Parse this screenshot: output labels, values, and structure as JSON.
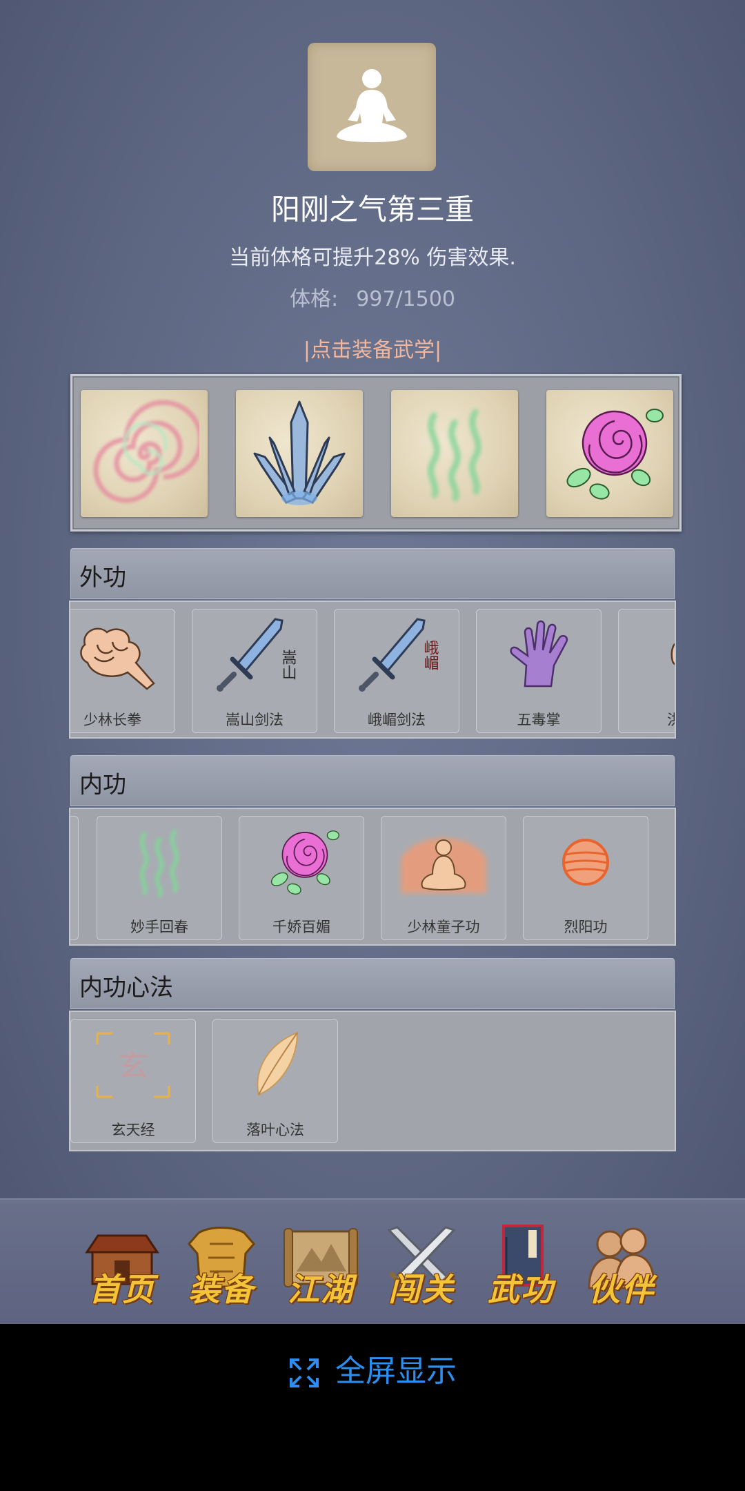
{
  "current_skill": {
    "title": "阳刚之气第三重",
    "description": "当前体格可提升28% 伤害效果.",
    "stat_label": "体格:",
    "stat_value": "997/1500"
  },
  "equip_hint": "|点击装备武学|",
  "equipped_slots": [
    "spiral-icon",
    "ice-blades-icon",
    "green-qi-icon",
    "rose-icon"
  ],
  "panels": {
    "outer": {
      "title": "外功",
      "skills": [
        {
          "label": "少林长拳",
          "icon": "fist-icon"
        },
        {
          "label": "嵩山剑法",
          "icon": "sword-icon",
          "mark": "嵩山"
        },
        {
          "label": "峨嵋剑法",
          "icon": "sword-icon",
          "mark": "峨嵋"
        },
        {
          "label": "五毒掌",
          "icon": "purple-palm-icon"
        },
        {
          "label": "洪",
          "icon": "fist-icon"
        }
      ]
    },
    "inner": {
      "title": "内功",
      "skills": [
        {
          "label": "妙手回春",
          "icon": "green-qi-icon"
        },
        {
          "label": "千娇百媚",
          "icon": "rose-icon"
        },
        {
          "label": "少林童子功",
          "icon": "meditating-monk-icon"
        },
        {
          "label": "烈阳功",
          "icon": "fire-orb-icon"
        }
      ]
    },
    "mind": {
      "title": "内功心法",
      "skills": [
        {
          "label": "玄天经",
          "icon": "xuan-glyph-icon",
          "mark": "玄"
        },
        {
          "label": "落叶心法",
          "icon": "leaf-icon"
        }
      ]
    }
  },
  "nav": [
    {
      "label": "首页",
      "icon": "house-icon"
    },
    {
      "label": "装备",
      "icon": "armor-icon"
    },
    {
      "label": "江湖",
      "icon": "scroll-map-icon"
    },
    {
      "label": "闯关",
      "icon": "crossed-swords-icon"
    },
    {
      "label": "武功",
      "icon": "manual-book-icon",
      "active": true
    },
    {
      "label": "伙伴",
      "icon": "companions-icon"
    }
  ],
  "fullscreen_label": "全屏显示",
  "colors": {
    "background": "#5e6782",
    "nav_text": "#f3c437",
    "hint_text": "#f2b79d",
    "fullscreen_text": "#2c8ff0"
  }
}
